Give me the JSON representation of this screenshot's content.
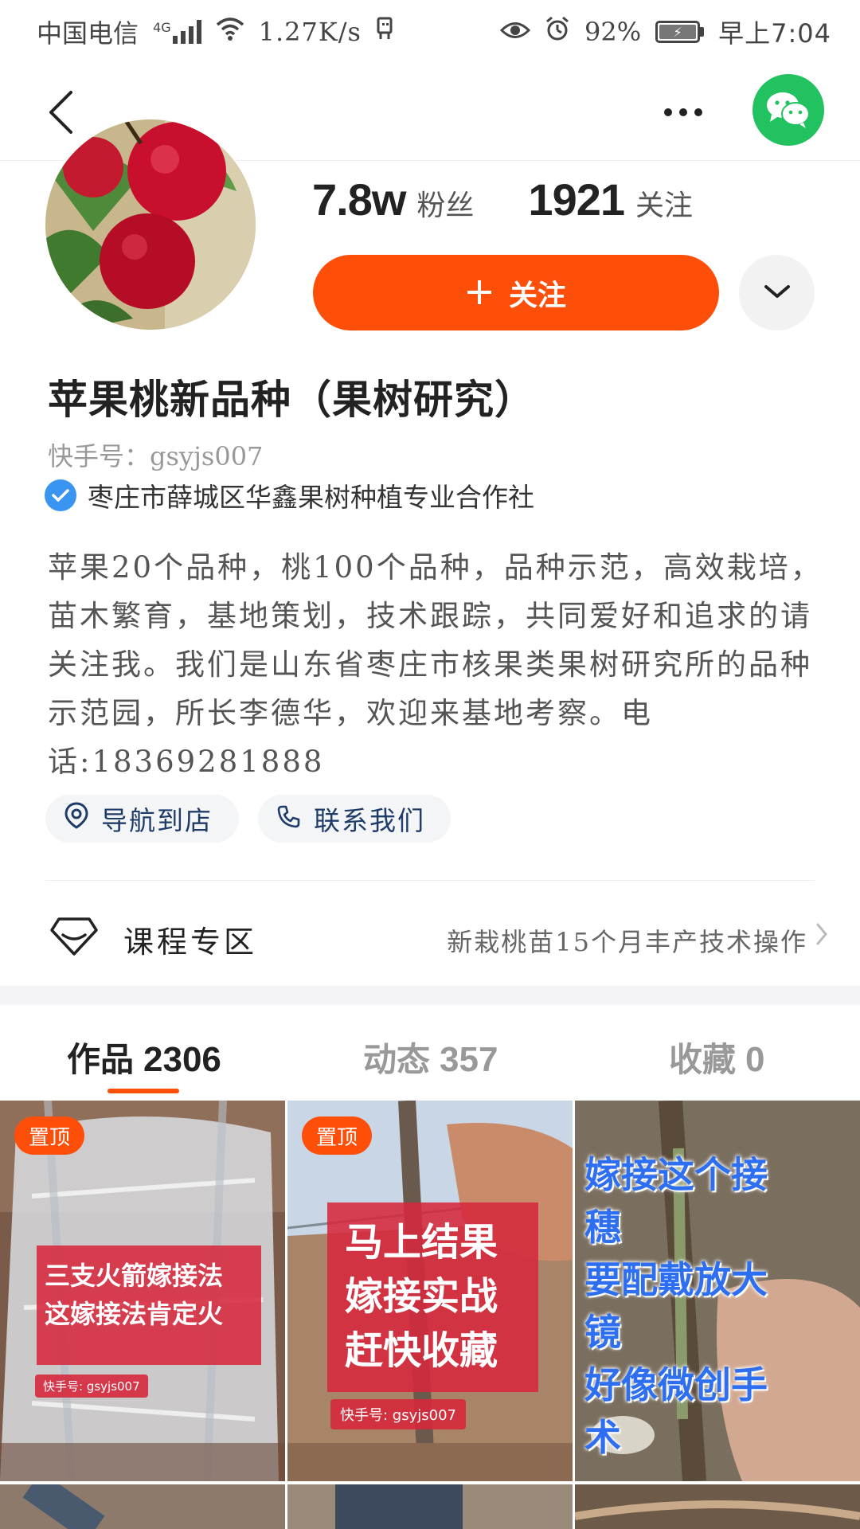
{
  "status_bar": {
    "carrier": "中国电信",
    "network": "4G",
    "speed": "1.27K/s",
    "battery": "92%",
    "time": "早上7:04"
  },
  "profile": {
    "fans_count": "7.8w",
    "fans_label": "粉丝",
    "following_count": "1921",
    "following_label": "关注",
    "follow_button": "关注",
    "name": "苹果桃新品种（果树研究）",
    "user_id": "快手号：gsyjs007",
    "verified_org": "枣庄市薛城区华鑫果树种植专业合作社",
    "bio": "苹果20个品种，桃100个品种，品种示范，高效栽培，苗木繁育，基地策划，技术跟踪，共同爱好和追求的请关注我。我们是山东省枣庄市核果类果树研究所的品种示范园，所长李德华，欢迎来基地考察。电话:18369281888",
    "nav_chip": "导航到店",
    "contact_chip": "联系我们"
  },
  "course": {
    "title": "课程专区",
    "desc": "新栽桃苗15个月丰产技术操作"
  },
  "tabs": [
    {
      "label": "作品",
      "count": "2306"
    },
    {
      "label": "动态",
      "count": "357"
    },
    {
      "label": "收藏",
      "count": "0"
    }
  ],
  "videos": [
    {
      "badge": "置顶",
      "caption_line1": "三支火箭嫁接法",
      "caption_line2": "这嫁接法肯定火",
      "watermark": "快手号: gsyjs007"
    },
    {
      "badge": "置顶",
      "caption_line1": "马上结果",
      "caption_line2": "嫁接实战",
      "caption_line3": "赶快收藏",
      "watermark": "快手号: gsyjs007"
    },
    {
      "caption_line1": "嫁接这个接穗",
      "caption_line2": "要配戴放大镜",
      "caption_line3": "好像微创手术"
    }
  ],
  "colors": {
    "accent": "#fe4f0a",
    "wechat": "#21c25f",
    "verified": "#3a94f1",
    "chip_text": "#1f3c68"
  }
}
